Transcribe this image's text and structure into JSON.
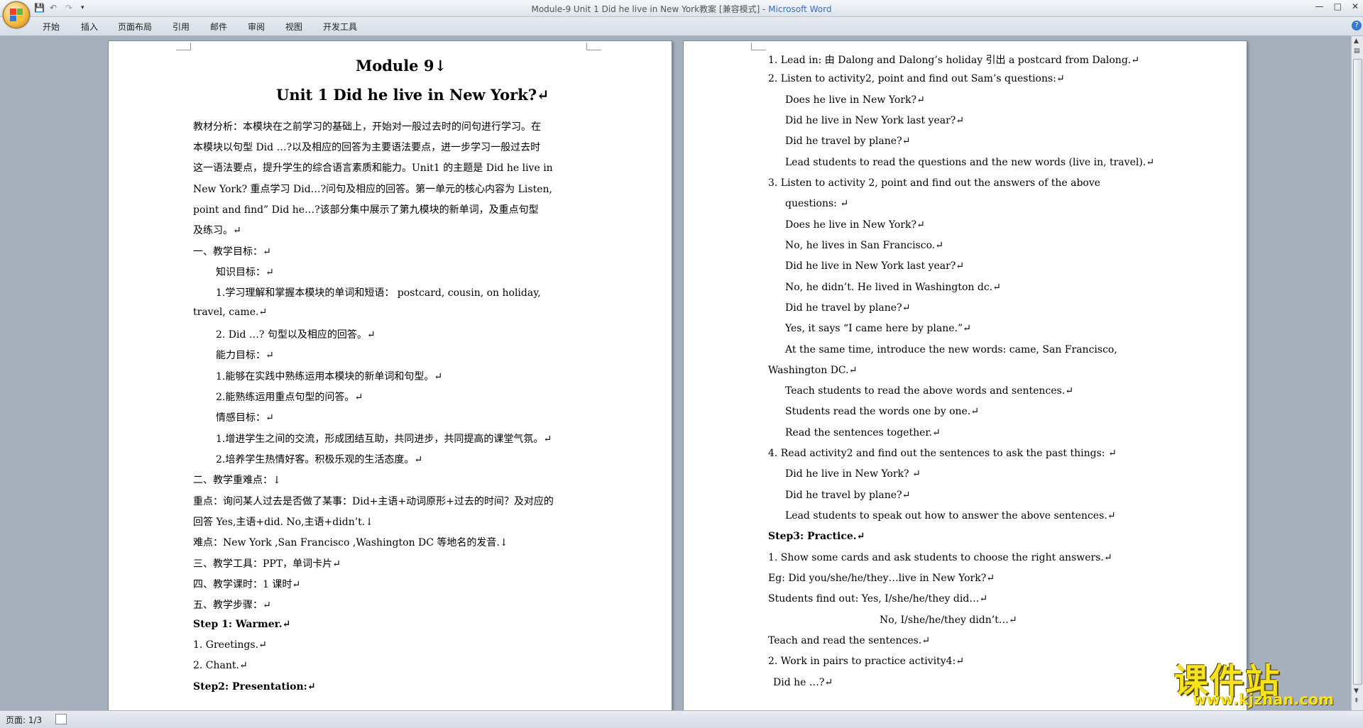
{
  "window": {
    "title_doc": "Module-9 Unit 1 Did he live in New York教案 [兼容模式] - ",
    "title_app": "Microsoft Word",
    "controls": [
      "—",
      "□",
      "✕"
    ]
  },
  "ribbon": {
    "tabs": [
      "开始",
      "插入",
      "页面布局",
      "引用",
      "邮件",
      "审阅",
      "视图",
      "开发工具"
    ]
  },
  "page_left": {
    "title1": "Module 9↓",
    "title2": "Unit 1 Did he live in New York?↵",
    "lines": [
      "教材分析：本模块在之前学习的基础上，开始对一般过去时的问句进行学习。在",
      "本模块以句型 Did …?以及相应的回答为主要语法要点，进一步学习一般过去时",
      "这一语法要点，提升学生的综合语言素质和能力。Unit1 的主题是 Did he live in",
      "New York? 重点学习 Did…?问句及相应的回答。第一单元的核心内容为 Listen,",
      "point and find” Did he…?该部分集中展示了第九模块的新单词，及重点句型",
      "及练习。↵",
      "一、教学目标：↵",
      "知识目标：↵",
      "1.学习理解和掌握本模块的单词和短语： postcard, cousin, on holiday,",
      "travel, came.↵",
      "2. Did …? 句型以及相应的回答。↵",
      "能力目标：↵",
      "1.能够在实践中熟练运用本模块的新单词和句型。↵",
      "2.能熟练运用重点句型的问答。↵",
      "情感目标：↵",
      "1.增进学生之间的交流，形成团结互助，共同进步，共同提高的课堂气氛。↵",
      "2.培养学生热情好客。积极乐观的生活态度。↵",
      "二、教学重难点：↓",
      "重点：询问某人过去是否做了某事：Did+主语+动词原形+过去的时间？及对应的",
      "回答 Yes,主语+did. No,主语+didn’t.↓",
      "难点：New York ,San Francisco ,Washington DC 等地名的发音.↓",
      "三、教学工具：PPT，单词卡片↵",
      "四、教学课时：1 课时↵",
      "五、教学步骤：↵",
      "Step 1: Warmer.↵",
      "1. Greetings.↵",
      "2. Chant.↵",
      "Step2: Presentation:↵"
    ]
  },
  "page_right": {
    "lines": [
      "1. Lead in: 由 Dalong and Dalong’s holiday 引出 a postcard from Dalong.↵",
      "2. Listen to activity2, point and find out Sam’s questions:↵",
      "Does he live in New York?↵",
      "Did he live in New York last year?↵",
      "Did he travel by plane?↵",
      "Lead students to read the questions and the new words (live in, travel).↵",
      "3. Listen to activity 2, point and find out the answers of the above",
      "questions: ↵",
      "Does he live in New York?↵",
      "No, he lives in San Francisco.↵",
      "Did he live in New York last year?↵",
      "No, he didn’t. He lived in Washington dc.↵",
      "Did he travel by plane?↵",
      "Yes, it says “I came here by plane.”↵",
      "At the same time, introduce the new words: came, San Francisco,",
      "Washington DC.↵",
      "Teach students to read the above words and sentences.↵",
      "Students read the words one by one.↵",
      "Read the sentences together.↵",
      "4. Read activity2 and find out the sentences to ask the past things: ↵",
      "Did he live in New York? ↵",
      "Did he travel by plane?↵",
      "Lead students to speak out how to answer the above sentences.↵",
      "Step3: Practice.↵",
      "1. Show some cards and ask students to choose the right answers.↵",
      "Eg: Did you/she/he/they…live in New York?↵",
      "Students find out: Yes, I/she/he/they did…↵",
      "No, I/she/he/they didn’t…↵",
      "Teach and read the sentences.↵",
      "2. Work in pairs to practice activity4:↵",
      "Did he …?↵"
    ]
  },
  "status": {
    "page": "页面: 1/3"
  },
  "watermark": {
    "big": "课件站",
    "small": "www.kjzhan.com"
  },
  "colors": {
    "accent": "#3c6fb8",
    "workspace": "#a6b0bd",
    "watermark": "#f7e31c"
  }
}
